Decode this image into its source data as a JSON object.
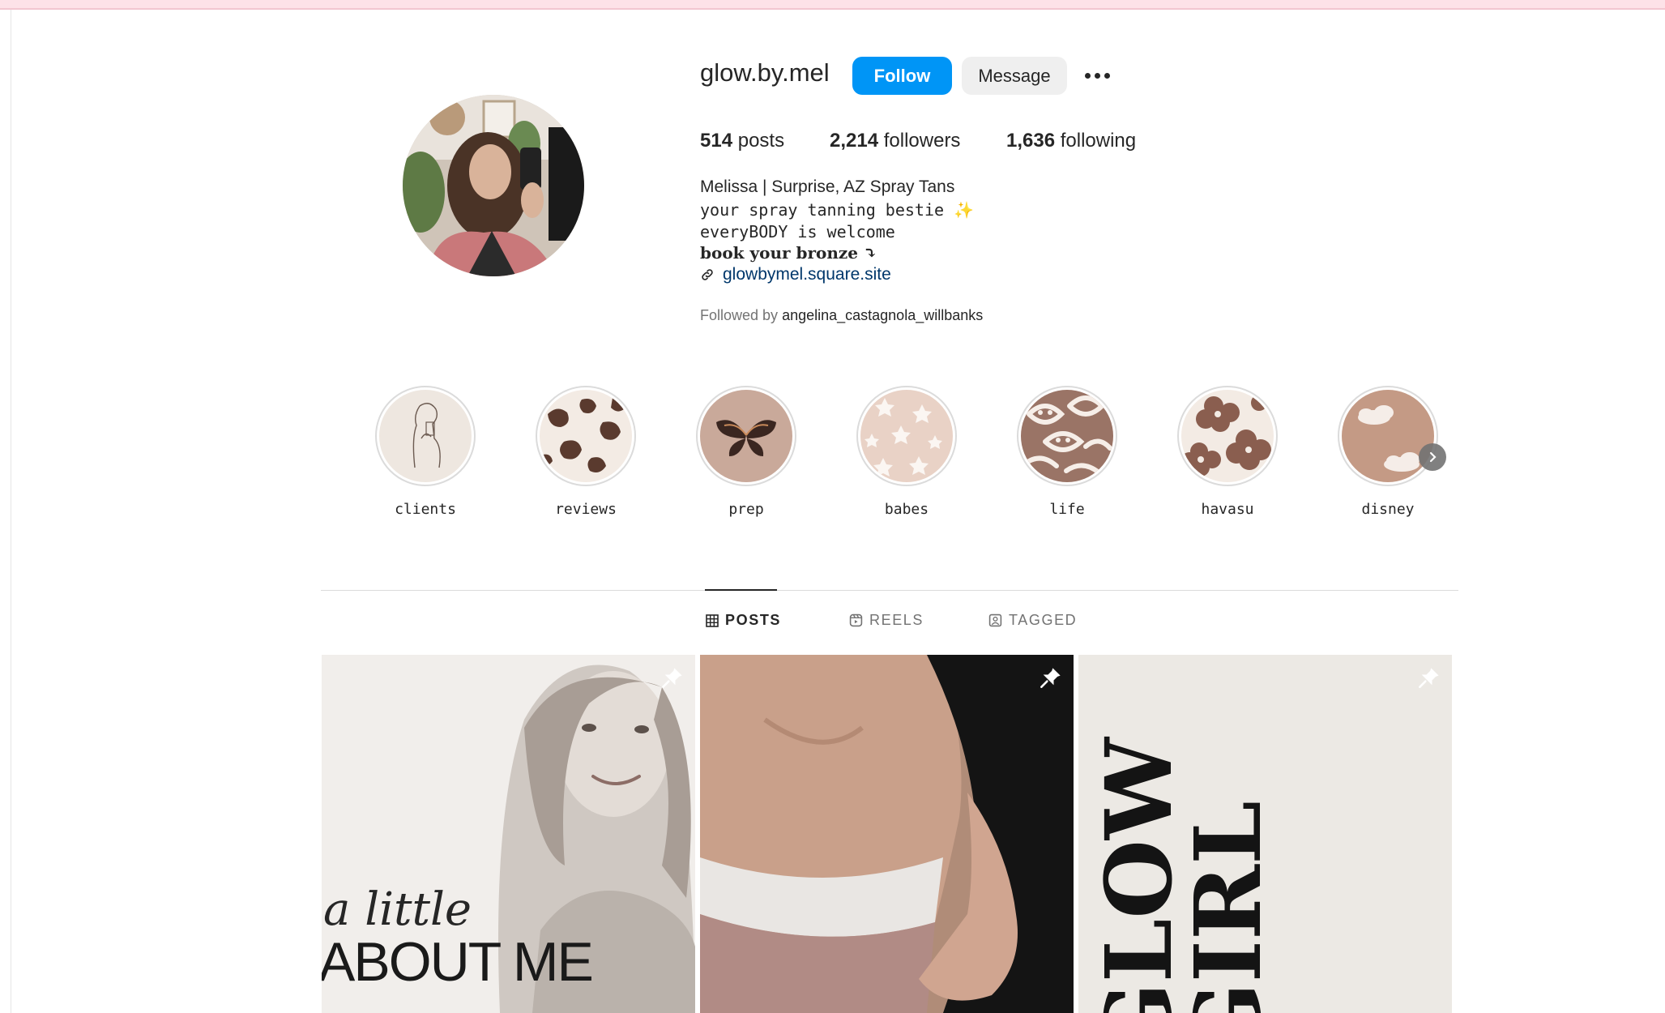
{
  "profile": {
    "username": "glow.by.mel",
    "follow_label": "Follow",
    "message_label": "Message",
    "stats": {
      "posts_count": "514",
      "posts_label": "posts",
      "followers_count": "2,214",
      "followers_label": "followers",
      "following_count": "1,636",
      "following_label": "following"
    },
    "bio": {
      "name": "Melissa | Surprise, AZ Spray Tans",
      "line1": "your spray tanning bestie ✨",
      "line2": "everyBODY is welcome",
      "line3": "book your bronze ⤵",
      "link": "glowbymel.square.site"
    },
    "followed_by": {
      "prefix": "Followed by",
      "name": "angelina_castagnola_willbanks"
    }
  },
  "highlights": [
    {
      "label": "clients"
    },
    {
      "label": "reviews"
    },
    {
      "label": "prep"
    },
    {
      "label": "babes"
    },
    {
      "label": "life"
    },
    {
      "label": "havasu"
    },
    {
      "label": "disney"
    }
  ],
  "tabs": {
    "posts": "POSTS",
    "reels": "REELS",
    "tagged": "TAGGED",
    "active": "POSTS"
  },
  "posts": [
    {
      "line1": "a little",
      "line2": "ABOUT ME",
      "pinned": true
    },
    {
      "pinned": true
    },
    {
      "line1": "GLOW",
      "line2": "GIRL",
      "pinned": true
    }
  ],
  "colors": {
    "accent": "#0095f6",
    "link": "#00376b",
    "text": "#262626",
    "muted": "#737373"
  },
  "icons": [
    "more-dots-icon",
    "link-icon",
    "chevron-right-icon",
    "grid-icon",
    "reels-icon",
    "tagged-icon",
    "pin-icon"
  ]
}
